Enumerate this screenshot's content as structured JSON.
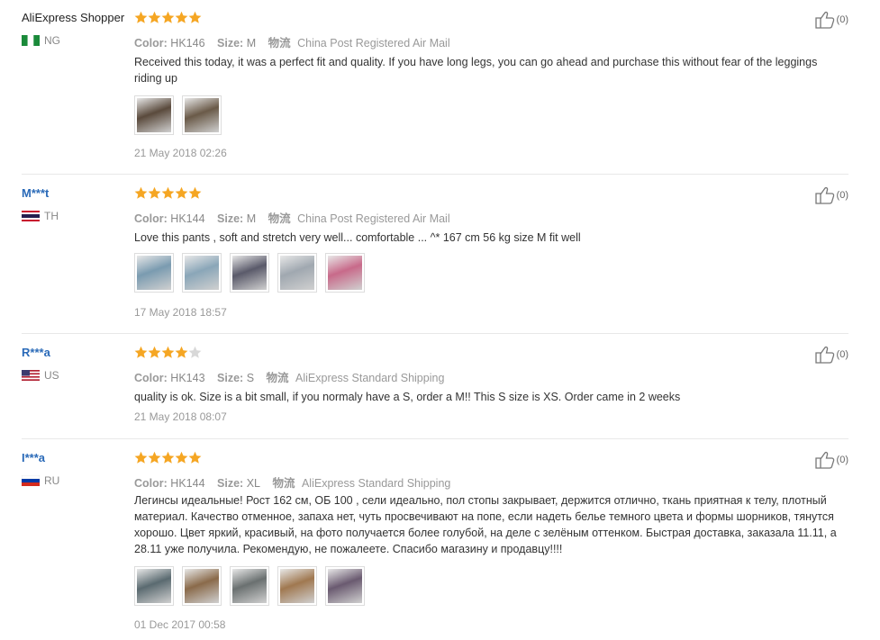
{
  "labels": {
    "color": "Color:",
    "size": "Size:",
    "shipping_icon": "物流"
  },
  "reviews": [
    {
      "name": "AliExpress Shopper",
      "country": "NG",
      "flag": "ng",
      "rating": 5,
      "color": "HK146",
      "size": "M",
      "shipping": "China Post Registered Air Mail",
      "text": "Received this today, it was a perfect fit and quality. If you have long legs, you can go ahead and purchase this without fear of the leggings riding up",
      "photos": [
        "#5a4a3c",
        "#6a5a48"
      ],
      "date": "21 May 2018 02:26",
      "helpful": "(0)"
    },
    {
      "name": "M***t",
      "country": "TH",
      "flag": "th",
      "rating": 5,
      "color": "HK144",
      "size": "M",
      "shipping": "China Post Registered Air Mail",
      "text": "Love this pants , soft and stretch very well... comfortable ... ^* 167 cm 56 kg size M fit well",
      "photos": [
        "#7a9bb0",
        "#8aa6b8",
        "#5a5a6a",
        "#a0a8b0",
        "#c86a8a"
      ],
      "date": "17 May 2018 18:57",
      "helpful": "(0)"
    },
    {
      "name": "R***a",
      "country": "US",
      "flag": "us",
      "rating": 4,
      "color": "HK143",
      "size": "S",
      "shipping": "AliExpress Standard Shipping",
      "text": "quality is ok. Size is a bit small, if you normaly have a S, order a M!! This S size is XS. Order came in 2 weeks",
      "photos": [],
      "date": "21 May 2018 08:07",
      "helpful": "(0)"
    },
    {
      "name": "I***a",
      "country": "RU",
      "flag": "ru",
      "rating": 5,
      "color": "HK144",
      "size": "XL",
      "shipping": "AliExpress Standard Shipping",
      "text": "Легинсы идеальные! Рост 162 см, ОБ 100 , сели идеально, пол стопы закрывает, держится отлично, ткань приятная к телу, плотный материал. Качество отменное, запаха нет, чуть просвечивают на попе, если надеть белье темного цвета и формы шорников, тянутся хорошо. Цвет яркий, красивый, на фото получается более голубой, на деле с зелёным оттенком. Быстрая доставка, заказала 11.11, а 28.11 уже получила. Рекомендую, не пожалеете. Спасибо магазину и продавцу!!!!",
      "photos": [
        "#5a6a70",
        "#8a6a4a",
        "#6a7070",
        "#a07850",
        "#6a5a70"
      ],
      "date": "01 Dec 2017 00:58",
      "helpful": "(0)"
    }
  ],
  "colors": {
    "star": "#f5a623",
    "star_empty": "#d8d8d8",
    "link": "#2a6ab8"
  }
}
